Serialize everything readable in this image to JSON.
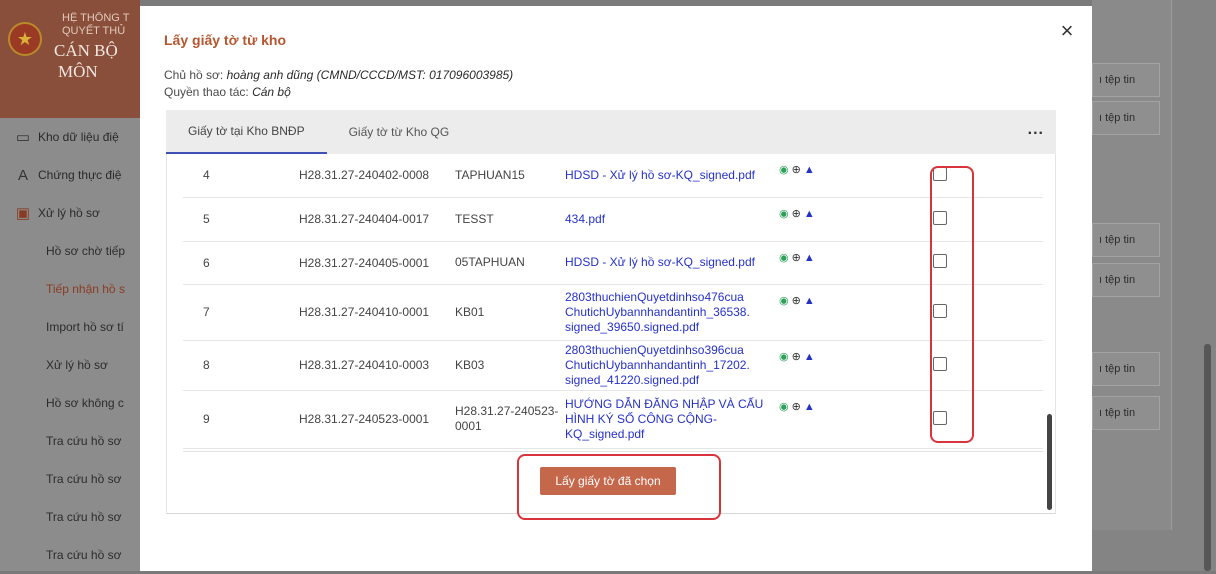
{
  "app": {
    "system_line": "HỆ THỐNG T\nQUYẾT THỦ",
    "role_line": "CÁN BỘ\nMÔN",
    "menu": [
      {
        "label": "Kho dữ liệu điệ",
        "icon": "archive-icon"
      },
      {
        "label": "Chứng thực điệ",
        "icon": "signature-icon"
      },
      {
        "label": "Xử lý hồ sơ",
        "icon": "folder-icon"
      }
    ],
    "submenu": [
      "Hồ sơ chờ tiếp",
      "Tiếp nhận hồ s",
      "Import hồ sơ tí",
      "Xử lý hồ sơ",
      "Hồ sơ không c",
      "Tra cứu hồ sơ",
      "Tra cứu hồ sơ",
      "Tra cứu hồ sơ",
      "Tra cứu hồ sơ"
    ],
    "right_buttons": [
      "ı tệp tin",
      "ı tệp tin",
      "ı tệp tin",
      "ı tệp tin",
      "ı tệp tin",
      "ı tệp tin"
    ]
  },
  "dialog": {
    "title": "Lấy giấy tờ từ kho",
    "owner_label": "Chủ hồ sơ:",
    "owner_value": "hoàng anh dũng (CMND/CCCD/MST: 017096003985)",
    "permission_label": "Quyền thao tác:",
    "permission_value": "Cán bộ",
    "tabs": [
      "Giấy tờ tại Kho BNĐP",
      "Giấy tờ từ Kho QG"
    ],
    "more_label": "...",
    "rows": [
      {
        "no": "4",
        "code": "H28.31.27-240402-0008",
        "name": "TAPHUAN15",
        "file": "HDSD - Xử lý hồ sơ-KQ_signed.pdf"
      },
      {
        "no": "5",
        "code": "H28.31.27-240404-0017",
        "name": "TESST",
        "file": "434.pdf"
      },
      {
        "no": "6",
        "code": "H28.31.27-240405-0001",
        "name": "05TAPHUAN",
        "file": "HDSD - Xử lý hồ sơ-KQ_signed.pdf"
      },
      {
        "no": "7",
        "code": "H28.31.27-240410-0001",
        "name": "KB01",
        "file": "2803thuchienQuyetdinhso476cua ChutichUybannhandantinh_36538. signed_39650.signed.pdf"
      },
      {
        "no": "8",
        "code": "H28.31.27-240410-0003",
        "name": "KB03",
        "file": "2803thuchienQuyetdinhso396cua ChutichUybannhandantinh_17202. signed_41220.signed.pdf"
      },
      {
        "no": "9",
        "code": "H28.31.27-240523-0001",
        "name": "H28.31.27-240523-0001",
        "file": "HƯỚNG DẪN ĐĂNG NHẬP VÀ CẤU HÌNH KÝ SỐ CÔNG CỘNG-KQ_signed.pdf"
      }
    ],
    "submit_label": "Lấy giấy tờ đã chọn",
    "close_icon": "×"
  },
  "colors": {
    "accent": "#b5562f",
    "button": "#c4674a",
    "link": "#2631c8",
    "highlight": "#d9343b",
    "tab_indicator": "#3f51b5"
  }
}
